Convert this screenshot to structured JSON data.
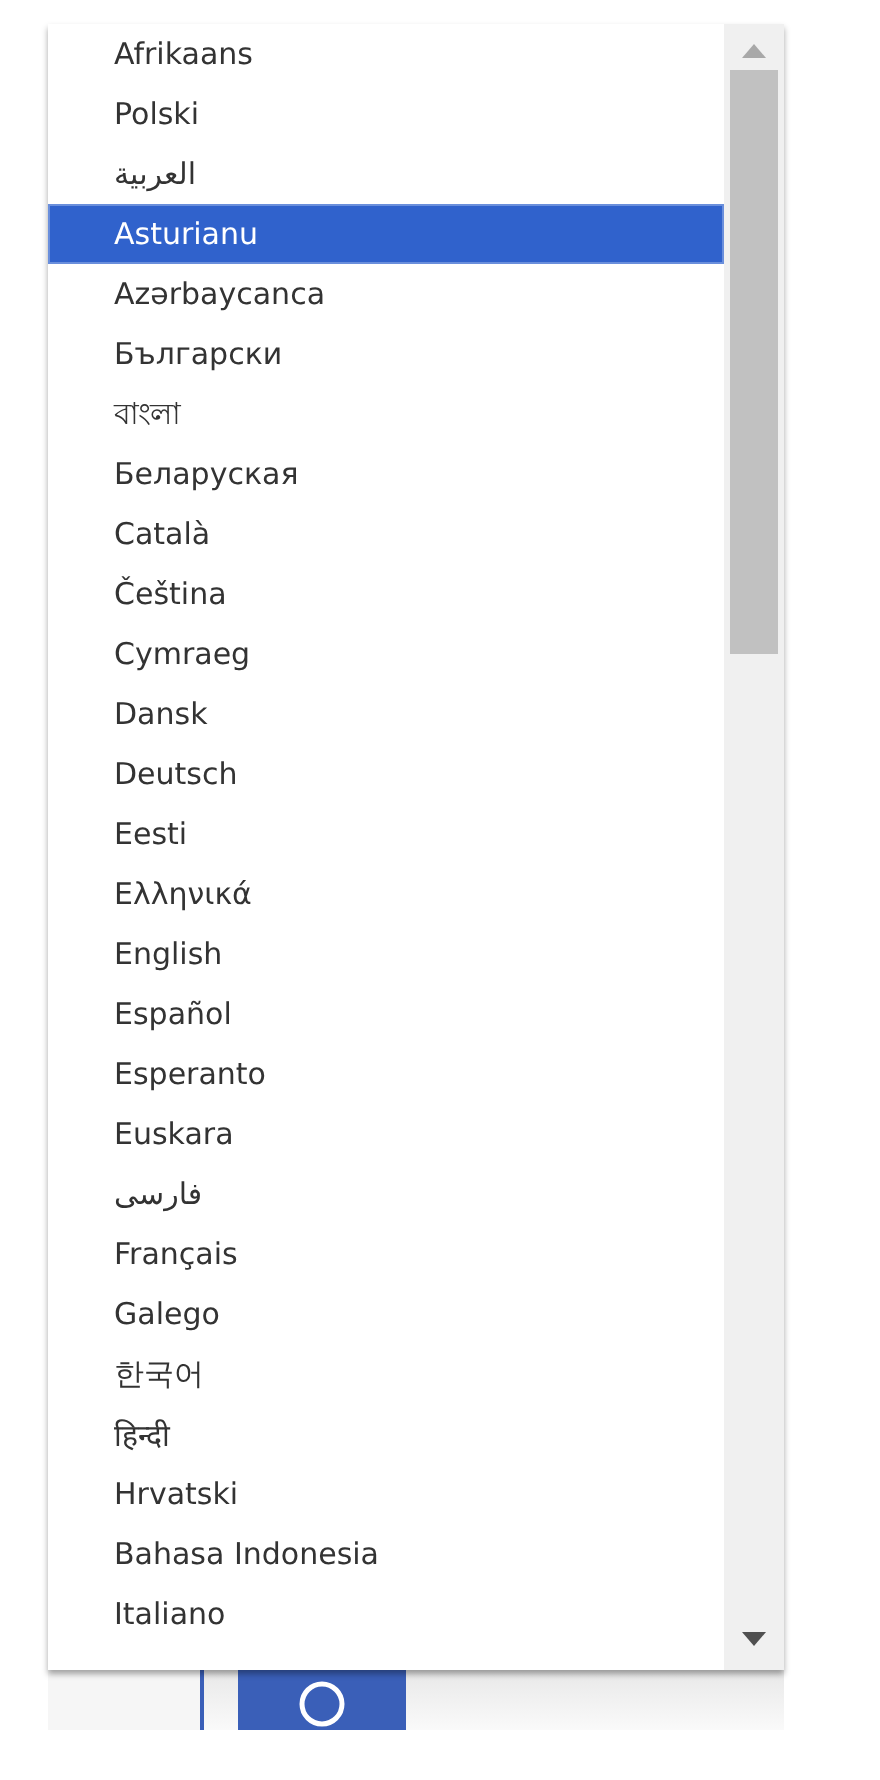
{
  "language_list": {
    "items": [
      {
        "label": "Afrikaans",
        "selected": false
      },
      {
        "label": "Polski",
        "selected": false
      },
      {
        "label": "العربية",
        "selected": false
      },
      {
        "label": "Asturianu",
        "selected": true
      },
      {
        "label": "Azərbaycanca",
        "selected": false
      },
      {
        "label": "Български",
        "selected": false
      },
      {
        "label": "বাংলা",
        "selected": false
      },
      {
        "label": "Беларуская",
        "selected": false
      },
      {
        "label": "Català",
        "selected": false
      },
      {
        "label": "Čeština",
        "selected": false
      },
      {
        "label": "Cymraeg",
        "selected": false
      },
      {
        "label": "Dansk",
        "selected": false
      },
      {
        "label": "Deutsch",
        "selected": false
      },
      {
        "label": "Eesti",
        "selected": false
      },
      {
        "label": "Ελληνικά",
        "selected": false
      },
      {
        "label": "English",
        "selected": false
      },
      {
        "label": "Español",
        "selected": false
      },
      {
        "label": "Esperanto",
        "selected": false
      },
      {
        "label": "Euskara",
        "selected": false
      },
      {
        "label": "فارسی",
        "selected": false
      },
      {
        "label": "Français",
        "selected": false
      },
      {
        "label": "Galego",
        "selected": false
      },
      {
        "label": "한국어",
        "selected": false
      },
      {
        "label": "हिन्दी",
        "selected": false
      },
      {
        "label": "Hrvatski",
        "selected": false
      },
      {
        "label": "Bahasa Indonesia",
        "selected": false
      },
      {
        "label": "Italiano",
        "selected": false
      }
    ]
  }
}
